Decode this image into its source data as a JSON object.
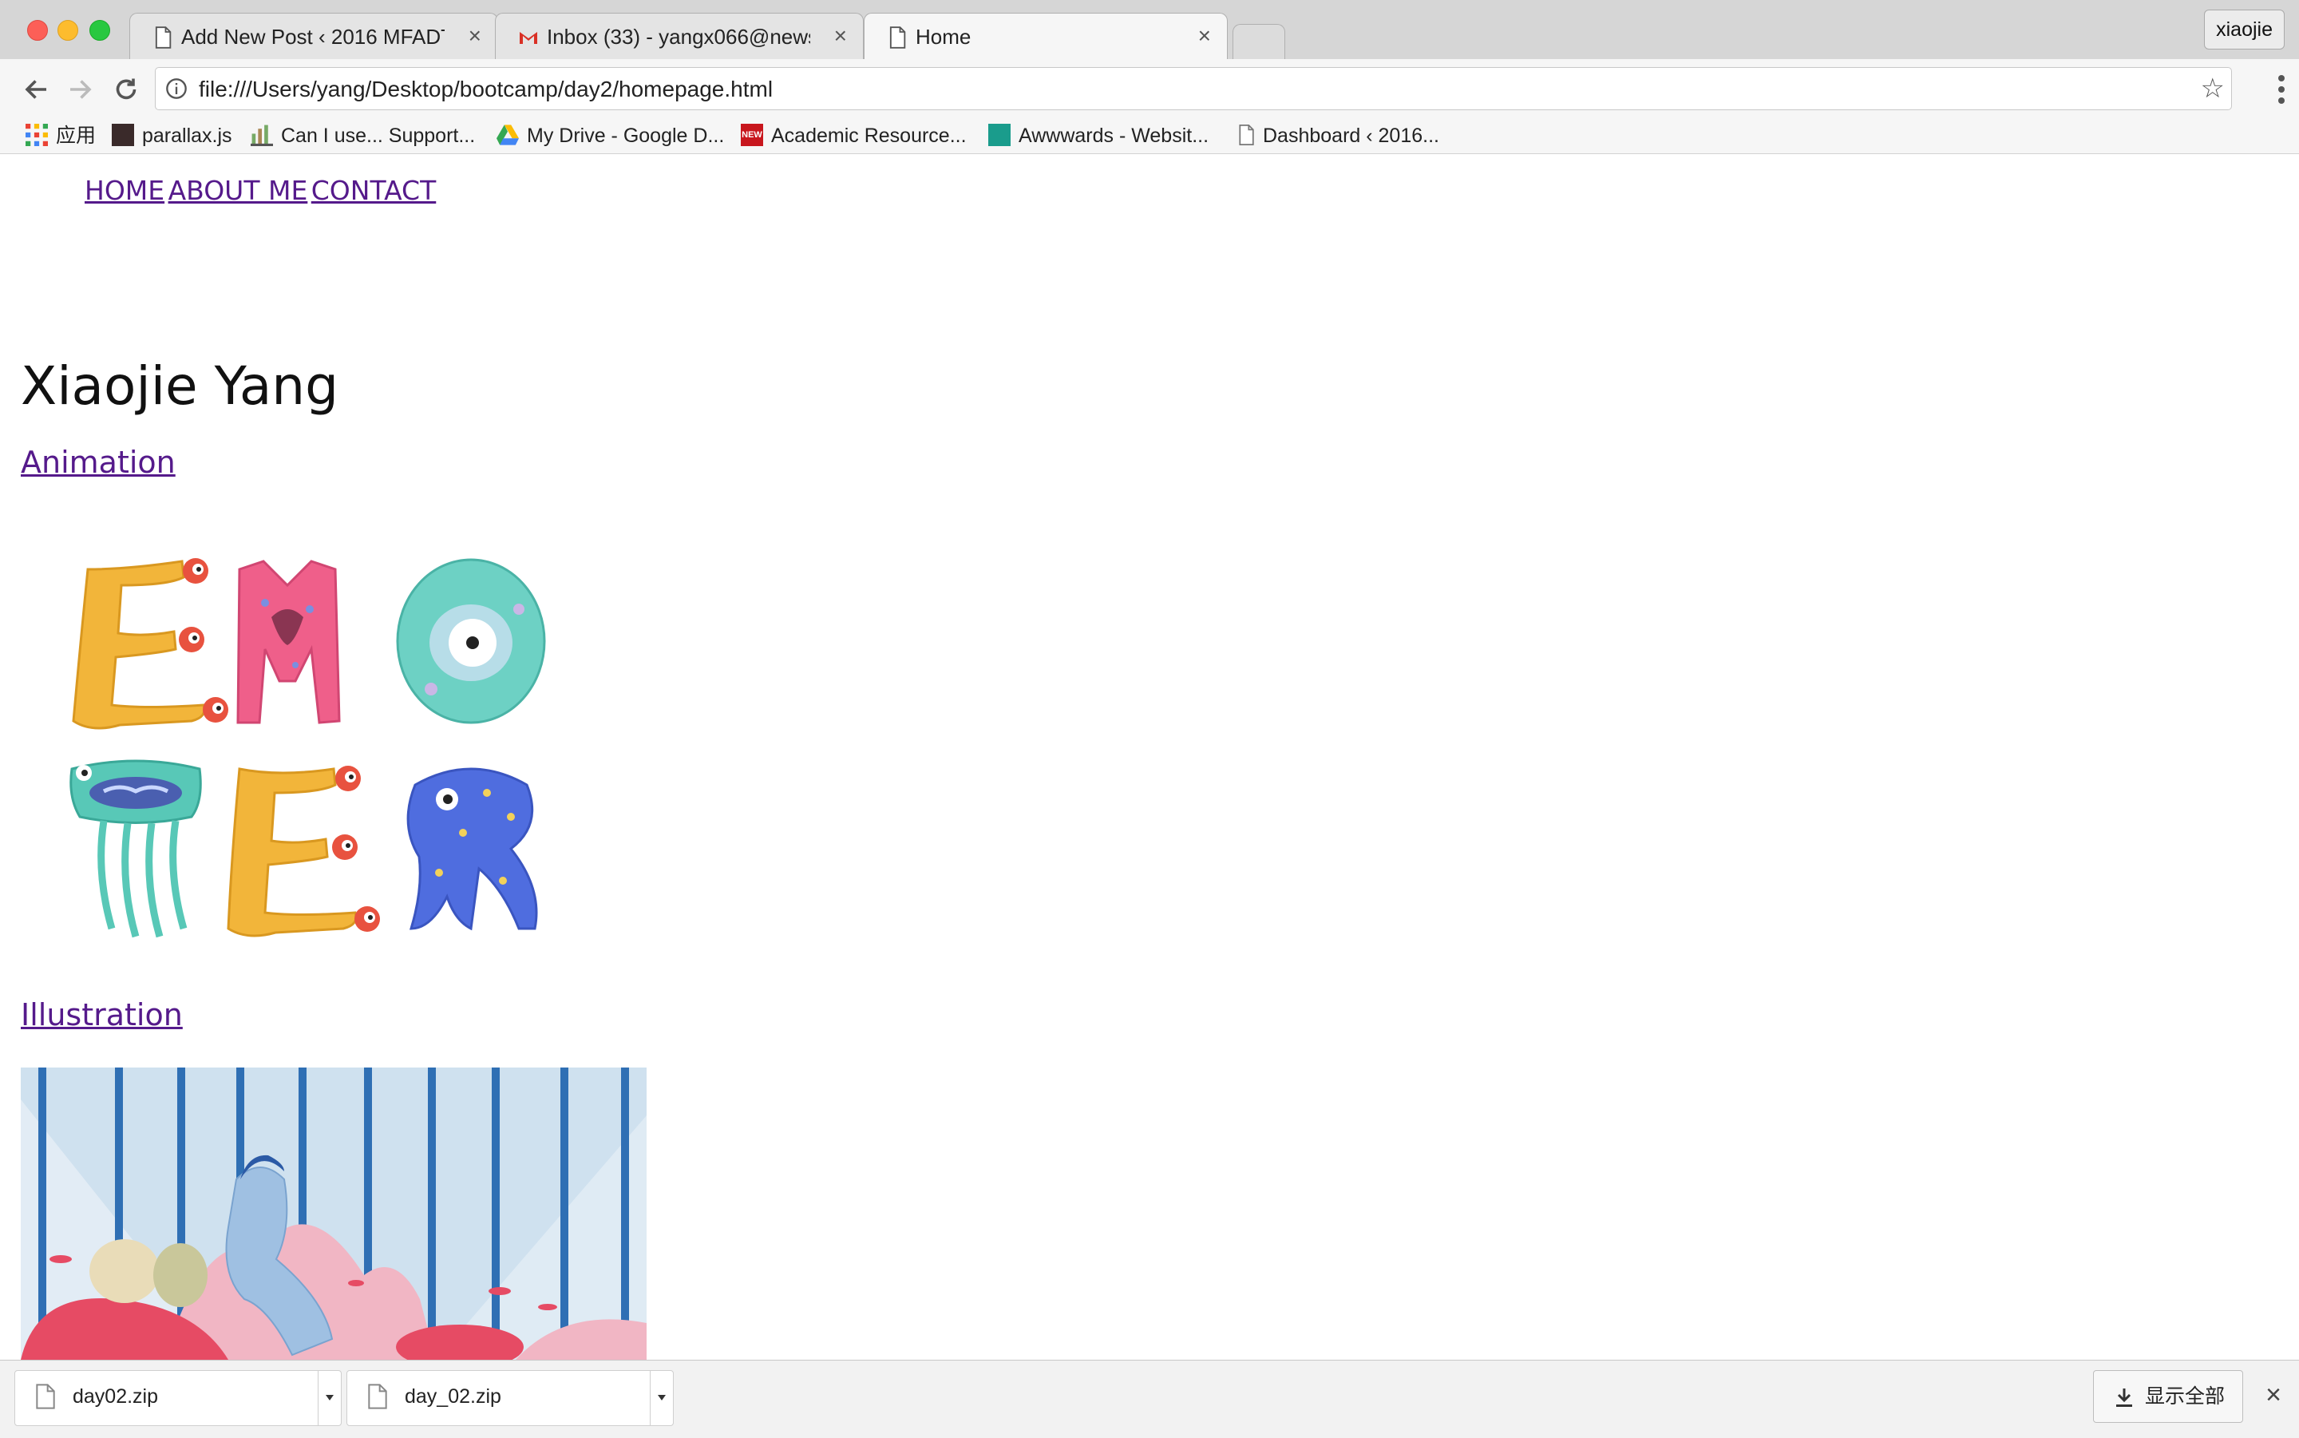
{
  "browser": {
    "tabs": [
      {
        "title": "Add New Post ‹ 2016 MFADT | ",
        "icon": "page-icon"
      },
      {
        "title": "Inbox (33) - yangx066@newsc",
        "icon": "gmail-icon"
      },
      {
        "title": "Home",
        "icon": "page-icon"
      }
    ],
    "tab_close": "×",
    "profile": "xiaojie",
    "url": "file:///Users/yang/Desktop/bootcamp/day2/homepage.html",
    "star": "☆",
    "bookmarks": [
      {
        "label": "应用",
        "icon": "apps-grid-icon"
      },
      {
        "label": "parallax.js",
        "icon": "parallax-icon"
      },
      {
        "label": "Can I use... Support...",
        "icon": "caniuse-icon"
      },
      {
        "label": "My Drive - Google D...",
        "icon": "google-drive-icon"
      },
      {
        "label": "Academic Resource...",
        "icon": "new-badge-icon"
      },
      {
        "label": "Awwwards - Websit...",
        "icon": "awwwards-icon"
      },
      {
        "label": "Dashboard ‹ 2016...",
        "icon": "page-icon"
      }
    ]
  },
  "page": {
    "nav": [
      "HOME",
      "ABOUT ME",
      "CONTACT"
    ],
    "name": "Xiaojie Yang",
    "sections": [
      "Animation",
      "Illustration"
    ]
  },
  "downloads": {
    "items": [
      "day02.zip",
      "day_02.zip"
    ],
    "show_all": "显示全部",
    "close": "×"
  },
  "colors": {
    "link": "#551a8b",
    "close_light": "#fc5f57",
    "minimize_light": "#fdbc2e",
    "zoom_light": "#28c840"
  }
}
